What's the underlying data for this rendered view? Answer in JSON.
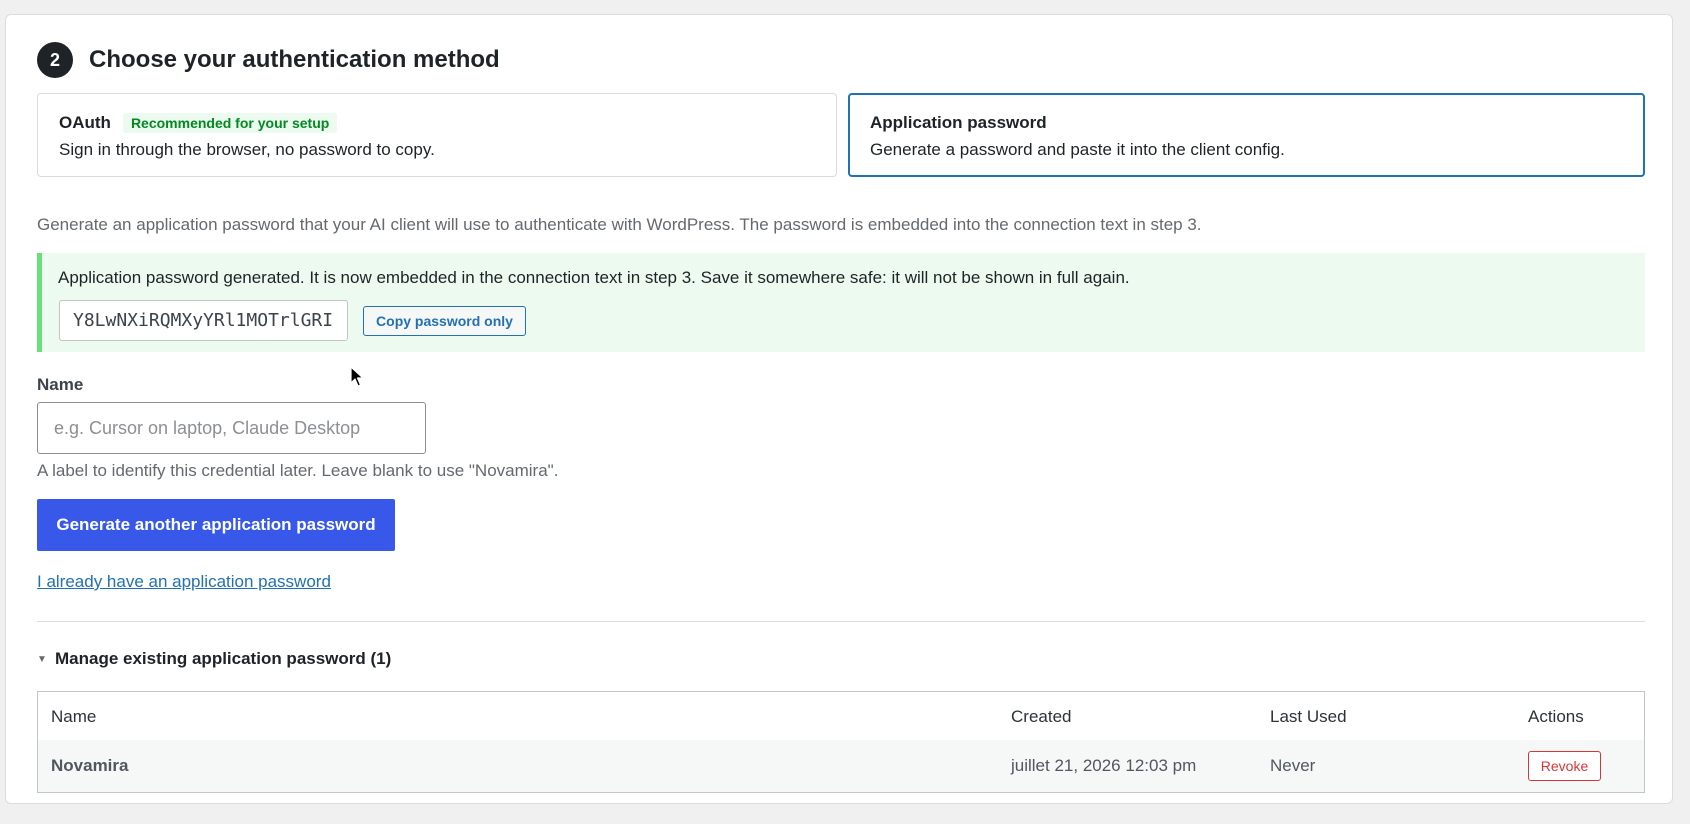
{
  "step": {
    "number": "2",
    "title": "Choose your authentication method"
  },
  "methods": {
    "oauth": {
      "title": "OAuth",
      "badge": "Recommended for your setup",
      "description": "Sign in through the browser, no password to copy."
    },
    "app_password": {
      "title": "Application password",
      "description": "Generate a password and paste it into the client config.",
      "selected": true
    }
  },
  "intro": "Generate an application password that your AI client will use to authenticate with WordPress. The password is embedded into the connection text in step 3.",
  "notice": {
    "message": "Application password generated. It is now embedded in the connection text in step 3. Save it somewhere safe: it will not be shown in full again.",
    "password": "Y8LwNXiRQMXyYRl1MOTrlGRI",
    "copy_label": "Copy password only"
  },
  "name_field": {
    "label": "Name",
    "placeholder": "e.g. Cursor on laptop, Claude Desktop",
    "value": "",
    "help": "A label to identify this credential later. Leave blank to use \"Novamira\"."
  },
  "generate_button": "Generate another application password",
  "have_link": "I already have an application password",
  "manage": {
    "label": "Manage existing application password (1)",
    "columns": [
      "Name",
      "Created",
      "Last Used",
      "Actions"
    ],
    "rows": [
      {
        "name": "Novamira",
        "created": "juillet 21, 2026 12:03 pm",
        "last_used": "Never",
        "action": "Revoke"
      }
    ]
  },
  "colors": {
    "accent": "#3858e9",
    "selected_border": "#2271b1",
    "success_bg": "#edfaef",
    "success_border": "#68de7c",
    "danger": "#d63638"
  }
}
